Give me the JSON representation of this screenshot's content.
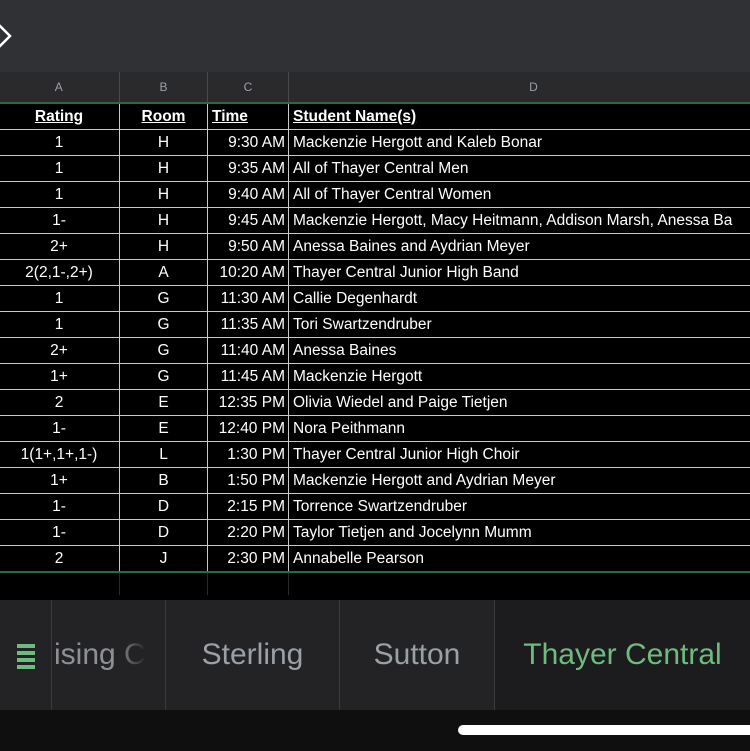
{
  "columns": [
    "A",
    "B",
    "C",
    "D"
  ],
  "header": {
    "rating": "Rating",
    "room": "Room",
    "time": "Time",
    "names": "Student Name(s)"
  },
  "rows": [
    {
      "rating": "1",
      "room": "H",
      "time": "9:30 AM",
      "names": "Mackenzie Hergott and Kaleb Bonar"
    },
    {
      "rating": "1",
      "room": "H",
      "time": "9:35 AM",
      "names": "All of Thayer Central Men"
    },
    {
      "rating": "1",
      "room": "H",
      "time": "9:40 AM",
      "names": "All of Thayer Central Women"
    },
    {
      "rating": "1-",
      "room": "H",
      "time": "9:45 AM",
      "names": "Mackenzie Hergott, Macy Heitmann, Addison Marsh, Anessa Ba"
    },
    {
      "rating": "2+",
      "room": "H",
      "time": "9:50 AM",
      "names": "Anessa Baines and Aydrian Meyer"
    },
    {
      "rating": "2(2,1-,2+)",
      "room": "A",
      "time": "10:20 AM",
      "names": "Thayer Central Junior High Band"
    },
    {
      "rating": "1",
      "room": "G",
      "time": "11:30 AM",
      "names": "Callie Degenhardt"
    },
    {
      "rating": "1",
      "room": "G",
      "time": "11:35 AM",
      "names": "Tori Swartzendruber"
    },
    {
      "rating": "2+",
      "room": "G",
      "time": "11:40 AM",
      "names": "Anessa Baines"
    },
    {
      "rating": "1+",
      "room": "G",
      "time": "11:45 AM",
      "names": "Mackenzie Hergott"
    },
    {
      "rating": "2",
      "room": "E",
      "time": "12:35 PM",
      "names": "Olivia Wiedel and Paige Tietjen"
    },
    {
      "rating": "1-",
      "room": "E",
      "time": "12:40 PM",
      "names": "Nora Peithmann"
    },
    {
      "rating": "1(1+,1+,1-)",
      "room": "L",
      "time": "1:30 PM",
      "names": "Thayer Central Junior High Choir"
    },
    {
      "rating": "1+",
      "room": "B",
      "time": "1:50 PM",
      "names": "Mackenzie Hergott and Aydrian Meyer"
    },
    {
      "rating": "1-",
      "room": "D",
      "time": "2:15 PM",
      "names": "Torrence Swartzendruber"
    },
    {
      "rating": "1-",
      "room": "D",
      "time": "2:20 PM",
      "names": "Taylor Tietjen and Jocelynn Mumm"
    },
    {
      "rating": "2",
      "room": "J",
      "time": "2:30 PM",
      "names": "Annabelle Pearson"
    }
  ],
  "tabs": {
    "partial_left": "ising C",
    "sterling": "Sterling",
    "sutton": "Sutton",
    "thayer": "Thayer Central"
  },
  "colors": {
    "active_tab": "#6fba7f",
    "grid_accent": "#2e6b3c"
  },
  "icons": {
    "close": "close-icon",
    "menu": "sheet-list-icon"
  }
}
